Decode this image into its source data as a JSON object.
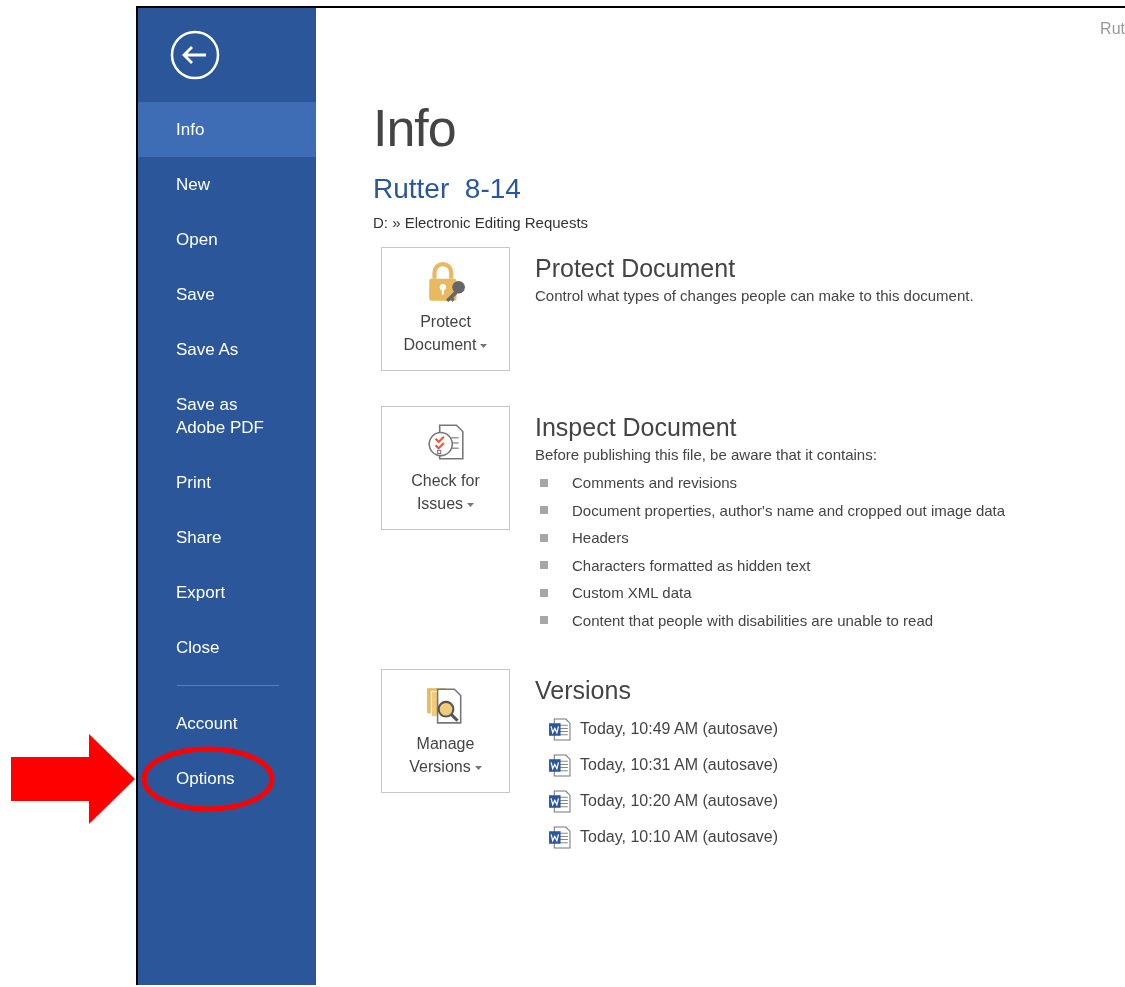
{
  "window": {
    "title": "Rut"
  },
  "sidebar": {
    "items": [
      {
        "label": "Info",
        "selected": true,
        "circled": false
      },
      {
        "label": "New",
        "selected": false,
        "circled": false
      },
      {
        "label": "Open",
        "selected": false,
        "circled": false
      },
      {
        "label": "Save",
        "selected": false,
        "circled": false
      },
      {
        "label": "Save As",
        "selected": false,
        "circled": false
      },
      {
        "label": "Save as Adobe PDF",
        "selected": false,
        "circled": false
      },
      {
        "label": "Print",
        "selected": false,
        "circled": false
      },
      {
        "label": "Share",
        "selected": false,
        "circled": false
      },
      {
        "label": "Export",
        "selected": false,
        "circled": false
      },
      {
        "label": "Close",
        "selected": false,
        "circled": false
      }
    ],
    "footer_items": [
      {
        "label": "Account",
        "selected": false,
        "circled": false
      },
      {
        "label": "Options",
        "selected": false,
        "circled": true
      }
    ]
  },
  "page": {
    "heading": "Info",
    "document_title": "Rutter  8-14",
    "path": "D: » Electronic Editing Requests"
  },
  "sections": [
    {
      "kind": "protect",
      "button_lines": [
        "Protect",
        "Document"
      ],
      "title": "Protect Document",
      "description": "Control what types of changes people can make to this document."
    },
    {
      "kind": "inspect",
      "button_lines": [
        "Check for",
        "Issues"
      ],
      "title": "Inspect Document",
      "description": "Before publishing this file, be aware that it contains:",
      "bullets": [
        "Comments and revisions",
        "Document properties, author's name and cropped out image data",
        "Headers",
        "Characters formatted as hidden text",
        "Custom XML data",
        "Content that people with disabilities are unable to read"
      ]
    },
    {
      "kind": "versions",
      "button_lines": [
        "Manage",
        "Versions"
      ],
      "title": "Versions",
      "versions": [
        "Today, 10:49 AM (autosave)",
        "Today, 10:31 AM (autosave)",
        "Today, 10:20 AM (autosave)",
        "Today, 10:10 AM (autosave)"
      ]
    }
  ]
}
